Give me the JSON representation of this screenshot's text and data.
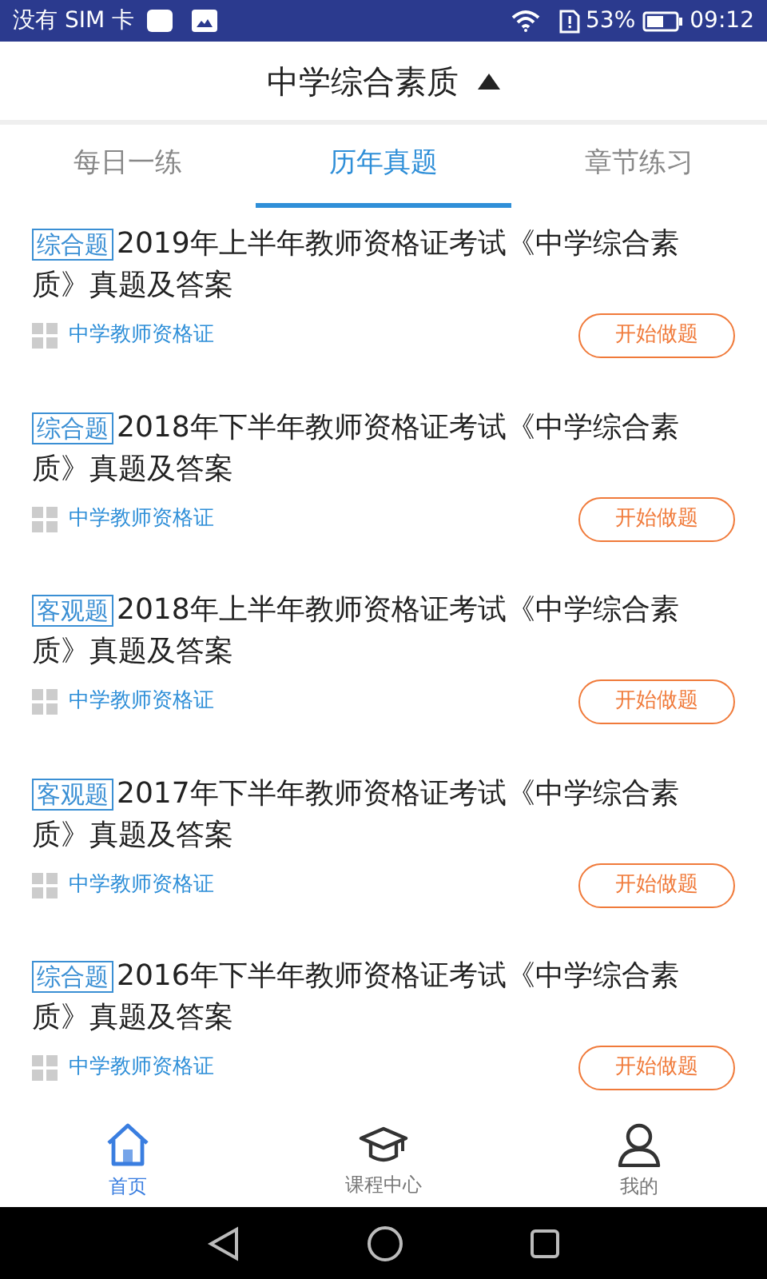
{
  "status_bar": {
    "carrier": "没有 SIM 卡",
    "battery": "53%",
    "time": "09:12"
  },
  "header": {
    "title": "中学综合素质",
    "expanded": true
  },
  "tabs": [
    {
      "label": "每日一练",
      "selected": false
    },
    {
      "label": "历年真题",
      "selected": true
    },
    {
      "label": "章节练习",
      "selected": false
    }
  ],
  "papers": [
    {
      "tag": "综合题",
      "title": "2019年上半年教师资格证考试《中学综合素质》真题及答案",
      "category": "中学教师资格证",
      "button": "开始做题"
    },
    {
      "tag": "综合题",
      "title": "2018年下半年教师资格证考试《中学综合素质》真题及答案",
      "category": "中学教师资格证",
      "button": "开始做题"
    },
    {
      "tag": "客观题",
      "title": "2018年上半年教师资格证考试《中学综合素质》真题及答案",
      "category": "中学教师资格证",
      "button": "开始做题"
    },
    {
      "tag": "客观题",
      "title": "2017年下半年教师资格证考试《中学综合素质》真题及答案",
      "category": "中学教师资格证",
      "button": "开始做题"
    },
    {
      "tag": "综合题",
      "title": "2016年下半年教师资格证考试《中学综合素质》真题及答案",
      "category": "中学教师资格证",
      "button": "开始做题"
    }
  ],
  "bottom_nav": [
    {
      "kind": "home",
      "label": "首页",
      "selected": true
    },
    {
      "kind": "course",
      "label": "课程中心",
      "selected": false
    },
    {
      "kind": "profile",
      "label": "我的",
      "selected": false
    }
  ]
}
